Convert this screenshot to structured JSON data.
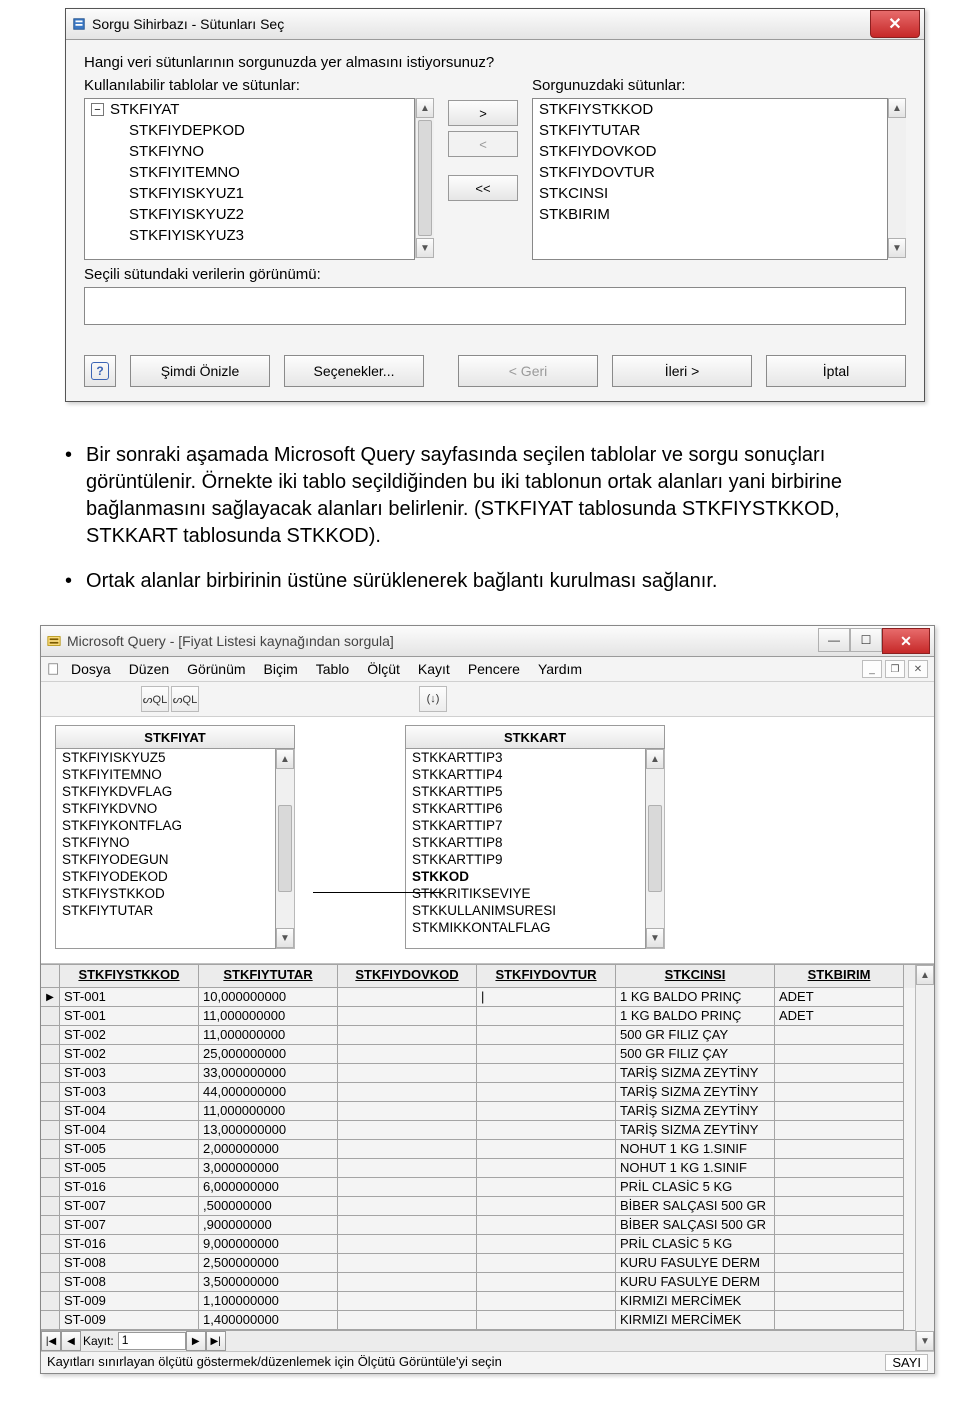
{
  "wizard": {
    "title": "Sorgu Sihirbazı - Sütunları Seç",
    "close_glyph": "✕",
    "question": "Hangi veri sütunlarının sorgunuzda yer almasını istiyorsunuz?",
    "available_label": "Kullanılabilir tablolar ve sütunlar:",
    "selected_label": "Sorgunuzdaki sütunlar:",
    "tree_root": "STKFIYAT",
    "tree_expand_glyph": "−",
    "tree_children": [
      "STKFIYDEPKOD",
      "STKFIYNO",
      "STKFIYITEMNO",
      "STKFIYISKYUZ1",
      "STKFIYISKYUZ2",
      "STKFIYISKYUZ3"
    ],
    "selected_cols": [
      "STKFIYSTKKOD",
      "STKFIYTUTAR",
      "STKFIYDOVKOD",
      "STKFIYDOVTUR",
      "STKCINSI",
      "STKBIRIM"
    ],
    "btn_add": ">",
    "btn_remove": "<",
    "btn_remove_all": "<<",
    "preview_label": "Seçili sütundaki verilerin görünümü:",
    "help_glyph": "?",
    "btn_preview": "Şimdi Önizle",
    "btn_options": "Seçenekler...",
    "btn_back": "< Geri",
    "btn_next": "İleri >",
    "btn_cancel": "İptal"
  },
  "doc": {
    "p1": "Bir sonraki aşamada Microsoft Query sayfasında seçilen tablolar ve sorgu sonuçları görüntülenir. Örnekte iki tablo seçildiğinden bu iki tablonun ortak alanları yani birbirine bağlanmasını sağlayacak alanları belirlenir. (STKFIYAT tablosunda STKFIYSTKKOD, STKKART tablosunda STKKOD).",
    "p2": "Ortak alanlar birbirinin üstüne sürüklenerek bağlantı kurulması sağlanır."
  },
  "mq": {
    "title": "Microsoft Query - [Fiyat Listesi kaynağından sorgula]",
    "sys_min": "—",
    "sys_max": "☐",
    "sys_close": "✕",
    "menu": [
      "Dosya",
      "Düzen",
      "Görünüm",
      "Biçim",
      "Tablo",
      "Ölçüt",
      "Kayıt",
      "Pencere",
      "Yardım"
    ],
    "sub_min": "_",
    "sub_max": "❐",
    "sub_close": "✕",
    "tool1a": "ᔕQL",
    "tool1b": "ᔕQL",
    "tool2": "(↓)",
    "table1": {
      "name": "STKFIYAT",
      "fields": [
        "STKFIYISKYUZ5",
        "STKFIYITEMNO",
        "STKFIYKDVFLAG",
        "STKFIYKDVNO",
        "STKFIYKONTFLAG",
        "STKFIYNO",
        "STKFIYODEGUN",
        "STKFIYODEKOD",
        "STKFIYSTKKOD",
        "STKFIYTUTAR"
      ]
    },
    "table2": {
      "name": "STKKART",
      "fields": [
        "STKKARTTIP3",
        "STKKARTTIP4",
        "STKKARTTIP5",
        "STKKARTTIP6",
        "STKKARTTIP7",
        "STKKARTTIP8",
        "STKKARTTIP9",
        "STKKOD",
        "STKKRITIKSEVIYE",
        "STKKULLANIMSURESI",
        "STKMIKKONTALFLAG"
      ],
      "bold_index": 7
    },
    "grid": {
      "headers": [
        "STKFIYSTKKOD",
        "STKFIYTUTAR",
        "STKFIYDOVKOD",
        "STKFIYDOVTUR",
        "STKCINSI",
        "STKBIRIM"
      ],
      "rows": [
        [
          "ST-001",
          "10,000000000",
          "",
          "",
          "1 KG BALDO PRINÇ",
          "ADET"
        ],
        [
          "ST-001",
          "11,000000000",
          "",
          "",
          "1 KG BALDO PRINÇ",
          "ADET"
        ],
        [
          "ST-002",
          "11,000000000",
          "",
          "",
          "500 GR FILIZ ÇAY",
          ""
        ],
        [
          "ST-002",
          "25,000000000",
          "",
          "",
          "500 GR FILIZ ÇAY",
          ""
        ],
        [
          "ST-003",
          "33,000000000",
          "",
          "",
          "TARİŞ SIZMA ZEYTİNY",
          ""
        ],
        [
          "ST-003",
          "44,000000000",
          "",
          "",
          "TARİŞ SIZMA ZEYTİNY",
          ""
        ],
        [
          "ST-004",
          "11,000000000",
          "",
          "",
          "TARİŞ SIZMA ZEYTİNY",
          ""
        ],
        [
          "ST-004",
          "13,000000000",
          "",
          "",
          "TARİŞ SIZMA ZEYTİNY",
          ""
        ],
        [
          "ST-005",
          "2,000000000",
          "",
          "",
          "NOHUT 1 KG 1.SINIF",
          ""
        ],
        [
          "ST-005",
          "3,000000000",
          "",
          "",
          "NOHUT 1 KG 1.SINIF",
          ""
        ],
        [
          "ST-016",
          "6,000000000",
          "",
          "",
          "PRİL CLASİC 5 KG",
          ""
        ],
        [
          "ST-007",
          ",500000000",
          "",
          "",
          "BİBER SALÇASI 500 GR",
          ""
        ],
        [
          "ST-007",
          ",900000000",
          "",
          "",
          "BİBER SALÇASI 500 GR",
          ""
        ],
        [
          "ST-016",
          "9,000000000",
          "",
          "",
          "PRİL CLASİC 5 KG",
          ""
        ],
        [
          "ST-008",
          "2,500000000",
          "",
          "",
          "KURU FASULYE DERM",
          ""
        ],
        [
          "ST-008",
          "3,500000000",
          "",
          "",
          "KURU FASULYE DERM",
          ""
        ],
        [
          "ST-009",
          "1,100000000",
          "",
          "",
          "KIRMIZI MERCİMEK",
          ""
        ],
        [
          "ST-009",
          "1,400000000",
          "",
          "",
          "KIRMIZI MERCİMEK",
          ""
        ]
      ],
      "marker": "▶",
      "caret": "|"
    },
    "record": {
      "label": "Kayıt:",
      "value": "1",
      "first": "|◀",
      "prev": "◀",
      "next": "▶",
      "last": "▶|"
    },
    "status_left": "Kayıtları sınırlayan ölçütü göstermek/düzenlemek için Ölçütü Görüntüle'yi seçin",
    "status_right": "SAYI"
  },
  "scroll": {
    "up": "▲",
    "down": "▼"
  }
}
